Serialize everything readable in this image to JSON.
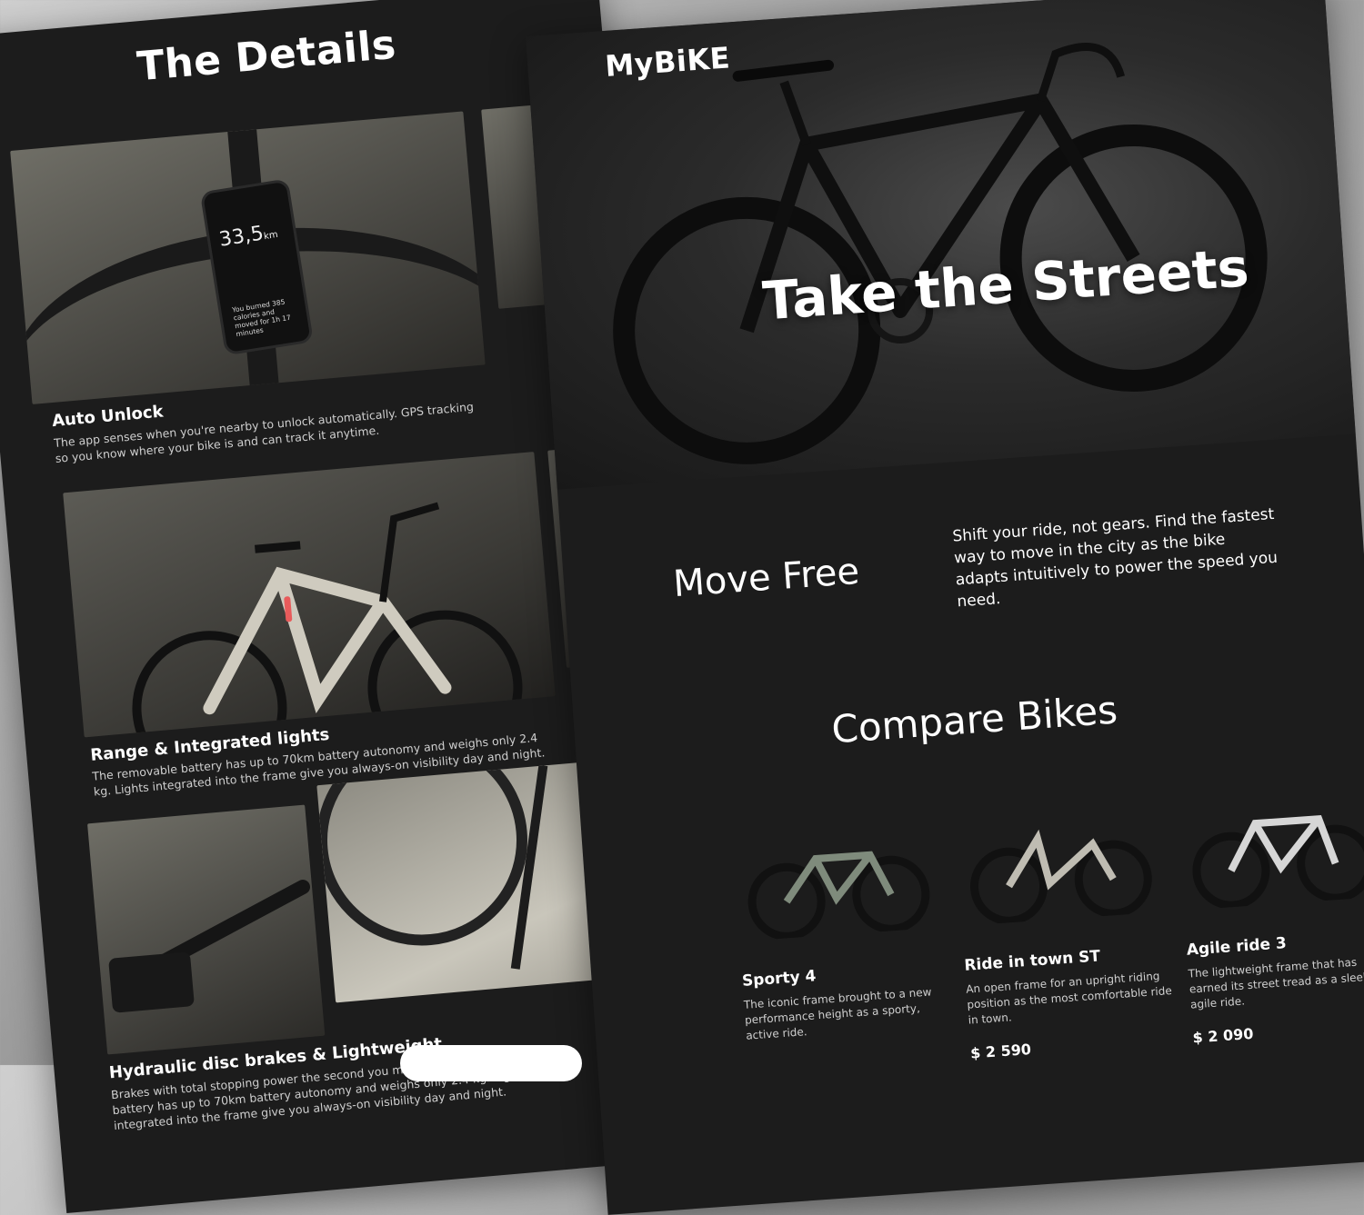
{
  "details": {
    "title": "The Details",
    "phone": {
      "distance": "33,5",
      "unit": "km",
      "summary": "You burned 385 calories and moved for 1h 17 minutes"
    },
    "features": [
      {
        "title": "Auto Unlock",
        "description": "The app senses when you're nearby to unlock automatically. GPS tracking so you know where your bike is and can track it anytime."
      },
      {
        "title": "Range & Integrated lights",
        "description": "The removable battery has up to 70km battery autonomy and weighs only 2.4 kg. Lights integrated into the frame give you always-on visibility day and night."
      },
      {
        "title": "Hydraulic disc brakes & Lightweight",
        "description": "Brakes with total stopping power the second you make contact. The removable battery has up to 70km battery autonomy and weighs only 2.4 kg. Lights integrated into the frame give you always-on visibility day and night."
      }
    ]
  },
  "header": {
    "logo": "MyBiKE",
    "phone_icon": "phone-icon",
    "menu_icon": "hamburger-menu-icon"
  },
  "hero": {
    "title": "Take the Streets"
  },
  "move": {
    "title": "Move Free",
    "text": "Shift your ride, not gears. Find the fastest way to move in the city as the bike adapts intuitively to power the speed you need."
  },
  "compare": {
    "title": "Compare Bikes",
    "bikes": [
      {
        "name": "Sporty 4",
        "description": "The iconic frame brought to a new performance height as a sporty, active ride.",
        "price": "",
        "frame_color": "#7f8b7c"
      },
      {
        "name": "Ride in town ST",
        "description": "An open frame for an upright riding position as the most comfortable ride in town.",
        "price": "$ 2 590",
        "frame_color": "#bfbcb2"
      },
      {
        "name": "Agile ride 3",
        "description": "The lightweight frame that has earned its street tread as a sleek, agile ride.",
        "price": "$ 2 090",
        "frame_color": "#d6d6d6"
      }
    ]
  }
}
